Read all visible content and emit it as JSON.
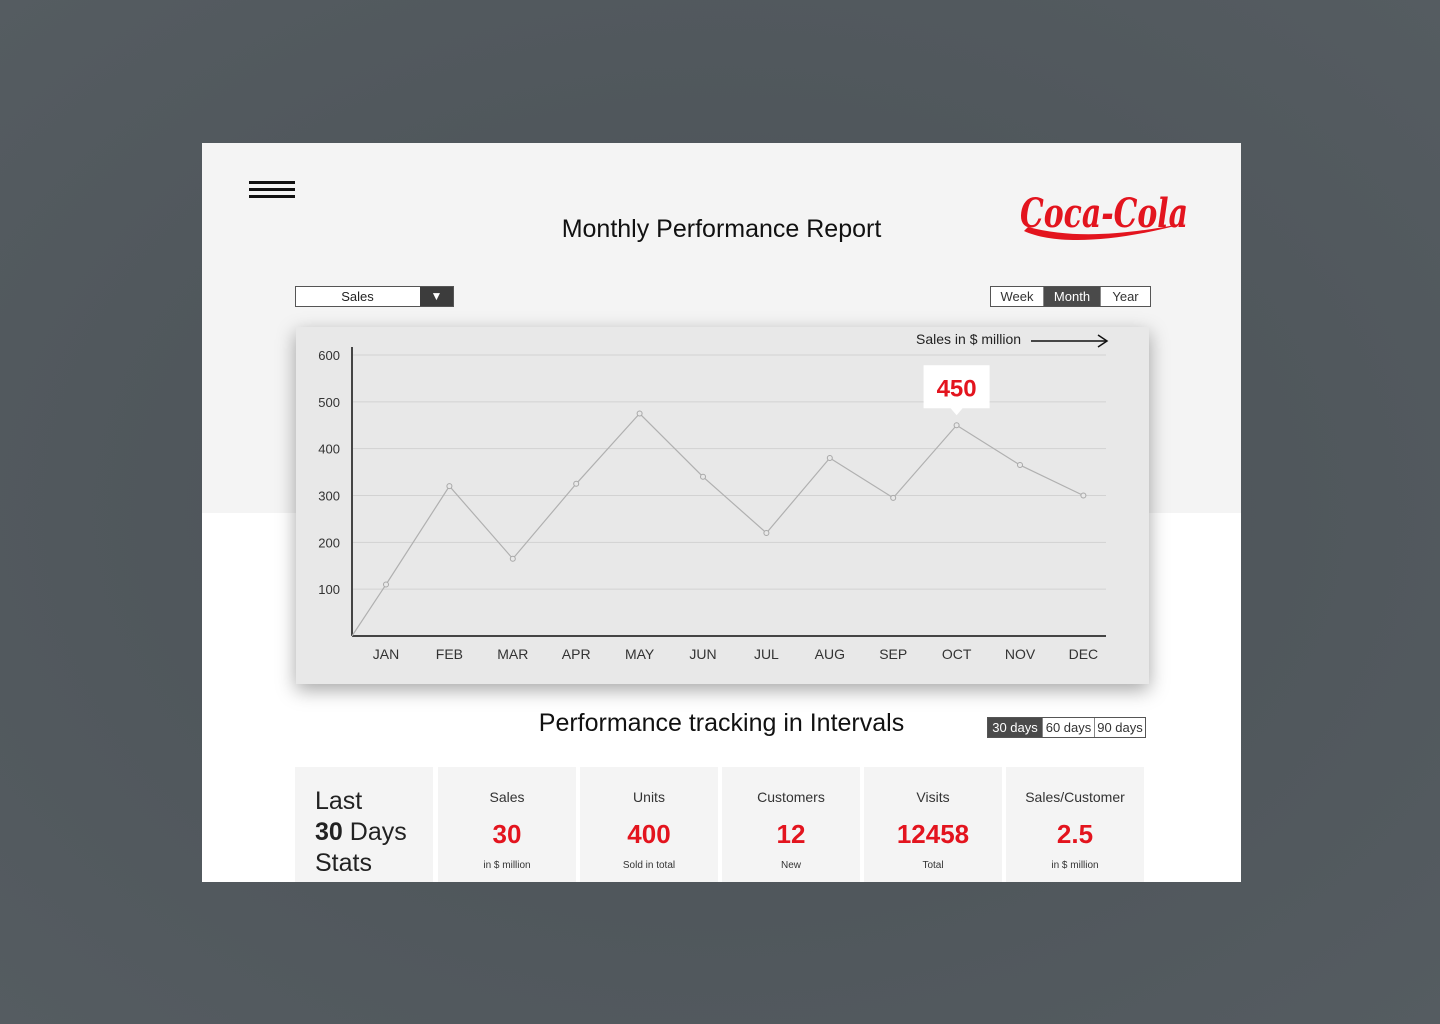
{
  "header": {
    "title": "Monthly Performance Report",
    "logo_text": "Coca-Cola",
    "brand_color": "#e3141e"
  },
  "metric_dropdown": {
    "selected": "Sales",
    "arrow": "▼"
  },
  "range_tabs": [
    {
      "label": "Week",
      "active": false
    },
    {
      "label": "Month",
      "active": true
    },
    {
      "label": "Year",
      "active": false
    }
  ],
  "chart_data": {
    "type": "line",
    "categories": [
      "JAN",
      "FEB",
      "MAR",
      "APR",
      "MAY",
      "JUN",
      "JUL",
      "AUG",
      "SEP",
      "OCT",
      "NOV",
      "DEC"
    ],
    "values": [
      110,
      320,
      165,
      325,
      475,
      340,
      220,
      380,
      295,
      450,
      365,
      300
    ],
    "x_start_value": 0,
    "ylim": [
      0,
      600
    ],
    "yticks": [
      100,
      200,
      300,
      400,
      500,
      600
    ],
    "ylabel": "Sales in $ million",
    "highlight": {
      "category": "OCT",
      "label": "450"
    },
    "grid": true
  },
  "intervals": {
    "title": "Performance tracking in Intervals",
    "tabs": [
      {
        "label": "30 days",
        "active": true
      },
      {
        "label": "60 days",
        "active": false
      },
      {
        "label": "90 days",
        "active": false
      }
    ]
  },
  "stats": {
    "lead": {
      "line1": "Last",
      "days_number": "30",
      "days_word": " Days",
      "line3": "Stats"
    },
    "items": [
      {
        "label": "Sales",
        "value": "30",
        "sub": "in $ million"
      },
      {
        "label": "Units",
        "value": "400",
        "sub": "Sold in total"
      },
      {
        "label": "Customers",
        "value": "12",
        "sub": "New"
      },
      {
        "label": "Visits",
        "value": "12458",
        "sub": "Total"
      },
      {
        "label": "Sales/Customer",
        "value": "2.5",
        "sub": "in $ million"
      }
    ]
  }
}
